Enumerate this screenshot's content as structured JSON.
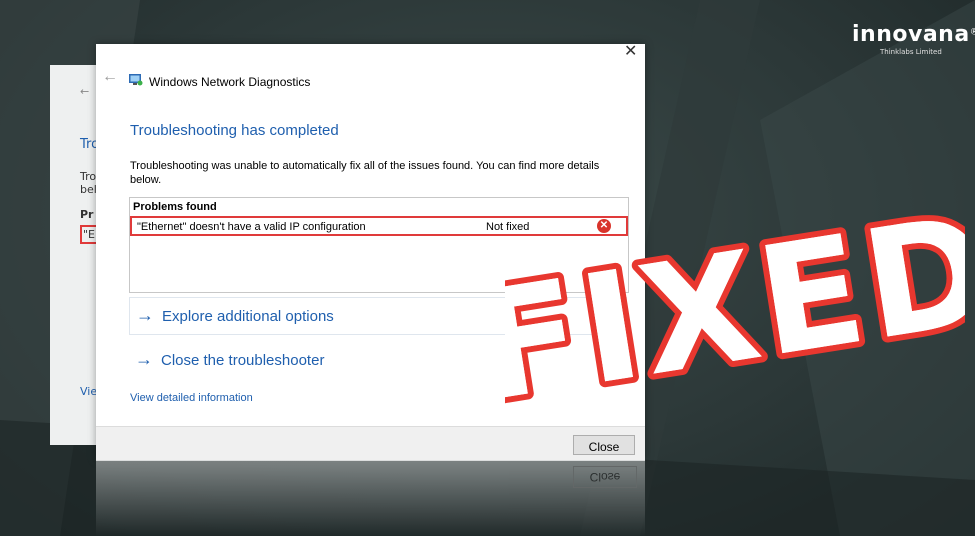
{
  "brand": {
    "name": "innovana",
    "registered": "®",
    "tagline": "Thinklabs Limited"
  },
  "stamp": {
    "text": "FIXED",
    "color": "#e8372f"
  },
  "ghost_window": {
    "lines": [
      "Tro",
      "Tro",
      "bel",
      "Pr",
      "\"E",
      "Vie"
    ]
  },
  "dialog": {
    "title": "Windows Network Diagnostics",
    "heading": "Troubleshooting has completed",
    "description": "Troubleshooting was unable to automatically fix all of the issues found. You can find more details below.",
    "problems": {
      "header": "Problems found",
      "rows": [
        {
          "issue": "\"Ethernet\" doesn't have a valid IP configuration",
          "status": "Not fixed",
          "icon": "error-icon"
        }
      ]
    },
    "options": [
      {
        "label": "Explore additional options",
        "icon": "arrow-right-icon"
      },
      {
        "label": "Close the troubleshooter",
        "icon": "arrow-right-icon"
      }
    ],
    "detail_link": "View detailed information",
    "close_button": "Close"
  },
  "colors": {
    "link_blue": "#1f5fae",
    "highlight_red": "#e03a3a",
    "background": "#2c3838"
  }
}
